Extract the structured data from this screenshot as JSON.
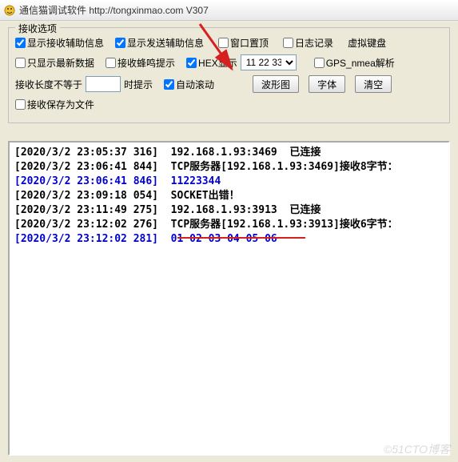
{
  "title": "通信猫调试软件  http://tongxinmao.com  V307",
  "group": {
    "legend": "接收选项",
    "row1": {
      "show_recv_aux": "显示接收辅助信息",
      "show_send_aux": "显示发送辅助信息",
      "window_top": "窗口置顶",
      "log_record": "日志记录",
      "virtual_kb": "虚拟键盘"
    },
    "row2": {
      "only_latest": "只显示最新数据",
      "beep": "接收蜂鸣提示",
      "hex": "HEX显示",
      "combo_value": "11 22 33",
      "gps": "GPS_nmea解析"
    },
    "row3": {
      "len_label": "接收长度不等于",
      "len_value": "",
      "time_hint": "时提示",
      "auto_scroll": "自动滚动",
      "btn_wave": "波形图",
      "btn_font": "字体",
      "btn_clear": "清空"
    },
    "row4": {
      "save_file": "接收保存为文件"
    }
  },
  "log": [
    {
      "c": "black",
      "text": "[2020/3/2 23:05:37 316]  192.168.1.93:3469  已连接"
    },
    {
      "c": "black",
      "text": "[2020/3/2 23:06:41 844]  TCP服务器[192.168.1.93:3469]接收8字节："
    },
    {
      "c": "blue",
      "text": "[2020/3/2 23:06:41 846]  11223344"
    },
    {
      "c": "black",
      "text": "[2020/3/2 23:09:18 054]  SOCKET出错！"
    },
    {
      "c": "black",
      "text": "[2020/3/2 23:11:49 275]  192.168.1.93:3913  已连接"
    },
    {
      "c": "black",
      "text": "[2020/3/2 23:12:02 276]  TCP服务器[192.168.1.93:3913]接收6字节："
    },
    {
      "c": "blue",
      "text": "[2020/3/2 23:12:02 281]  01 02 03 04 05 06"
    }
  ],
  "watermark": "©51CTO博客"
}
